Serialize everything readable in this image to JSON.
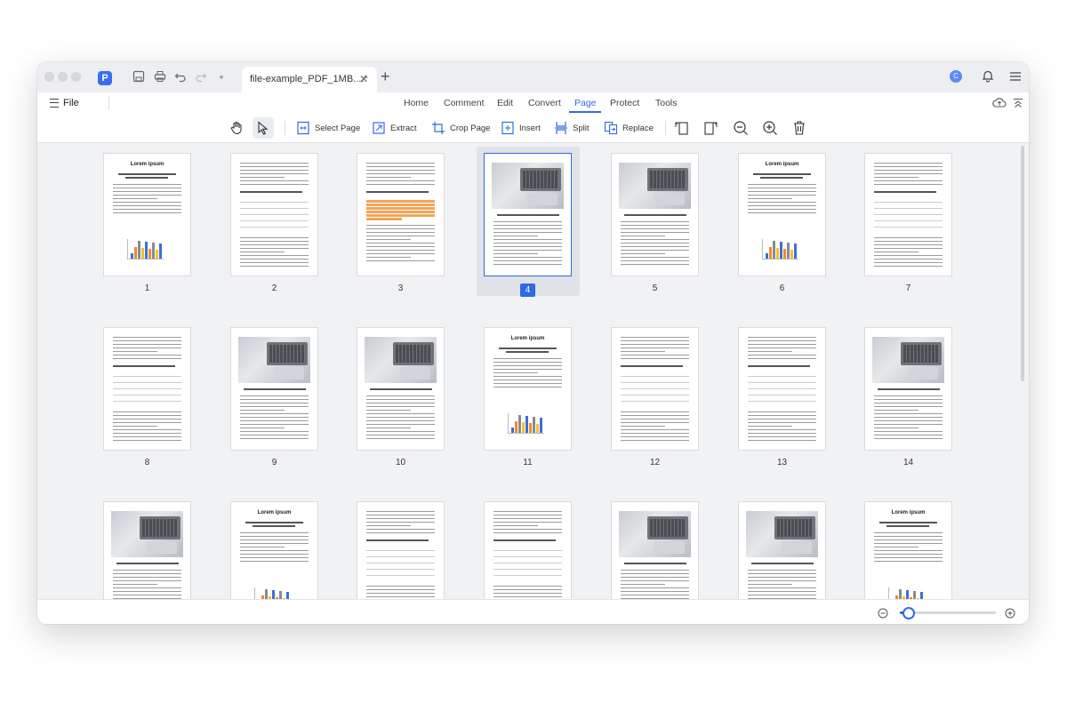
{
  "window": {
    "tab_title": "file-example_PDF_1MB....*",
    "tab_close": "✕",
    "new_tab": "+",
    "avatar_initial": "C"
  },
  "menubar": {
    "file_label": "File",
    "tabs": [
      "Home",
      "Comment",
      "Edit",
      "Convert",
      "Page",
      "Protect",
      "Tools"
    ],
    "active_tab": "Page"
  },
  "toolbar": {
    "select_page": "Select Page",
    "extract": "Extract",
    "crop_page": "Crop Page",
    "insert": "Insert",
    "split": "Split",
    "replace": "Replace"
  },
  "pages": {
    "selected": "4",
    "labels": [
      "1",
      "2",
      "3",
      "4",
      "5",
      "6",
      "7",
      "8",
      "9",
      "10",
      "11",
      "12",
      "13",
      "14"
    ],
    "heading_text": "Lorem ipsum"
  },
  "zoom": {
    "level_fraction": 0.08
  },
  "colors": {
    "accent": "#2f6ae5",
    "highlight": "#f3a55a"
  }
}
